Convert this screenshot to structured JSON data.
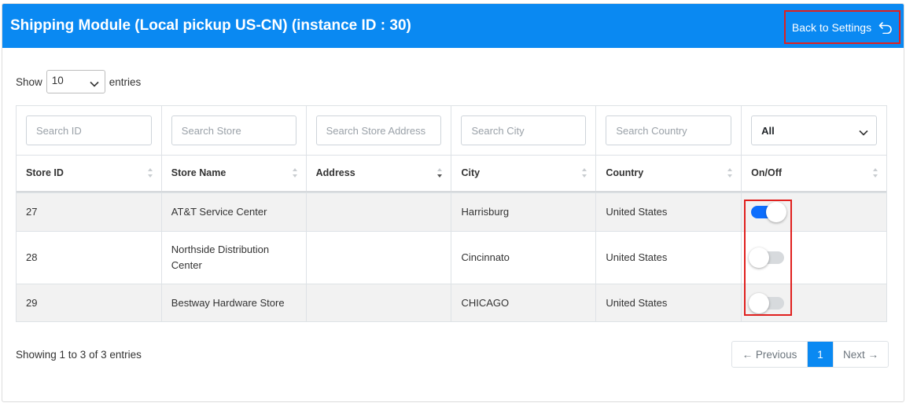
{
  "header": {
    "title": "Shipping Module (Local pickup US-CN) (instance ID : 30)",
    "back_label": "Back to Settings"
  },
  "length": {
    "show_label": "Show",
    "value": "10",
    "entries_label": "entries"
  },
  "filters": {
    "id_placeholder": "Search ID",
    "store_placeholder": "Search Store",
    "address_placeholder": "Search Store Address",
    "city_placeholder": "Search City",
    "country_placeholder": "Search Country",
    "status_value": "All"
  },
  "columns": [
    "Store ID",
    "Store Name",
    "Address",
    "City",
    "Country",
    "On/Off"
  ],
  "rows": [
    {
      "id": "27",
      "name": "AT&T Service Center",
      "address": "",
      "city": "Harrisburg",
      "country": "United States",
      "on": true
    },
    {
      "id": "28",
      "name": "Northside Distribution Center",
      "address": "",
      "city": "Cincinnato",
      "country": "United States",
      "on": false
    },
    {
      "id": "29",
      "name": "Bestway Hardware Store",
      "address": "",
      "city": "CHICAGO",
      "country": "United States",
      "on": false
    }
  ],
  "footer": {
    "info": "Showing 1 to 3 of 3 entries",
    "prev": "← Previous",
    "current": "1",
    "next": "Next →"
  },
  "colors": {
    "header": "#0a89f2",
    "highlight": "#e0201e",
    "toggle_on": "#0d6efd"
  }
}
